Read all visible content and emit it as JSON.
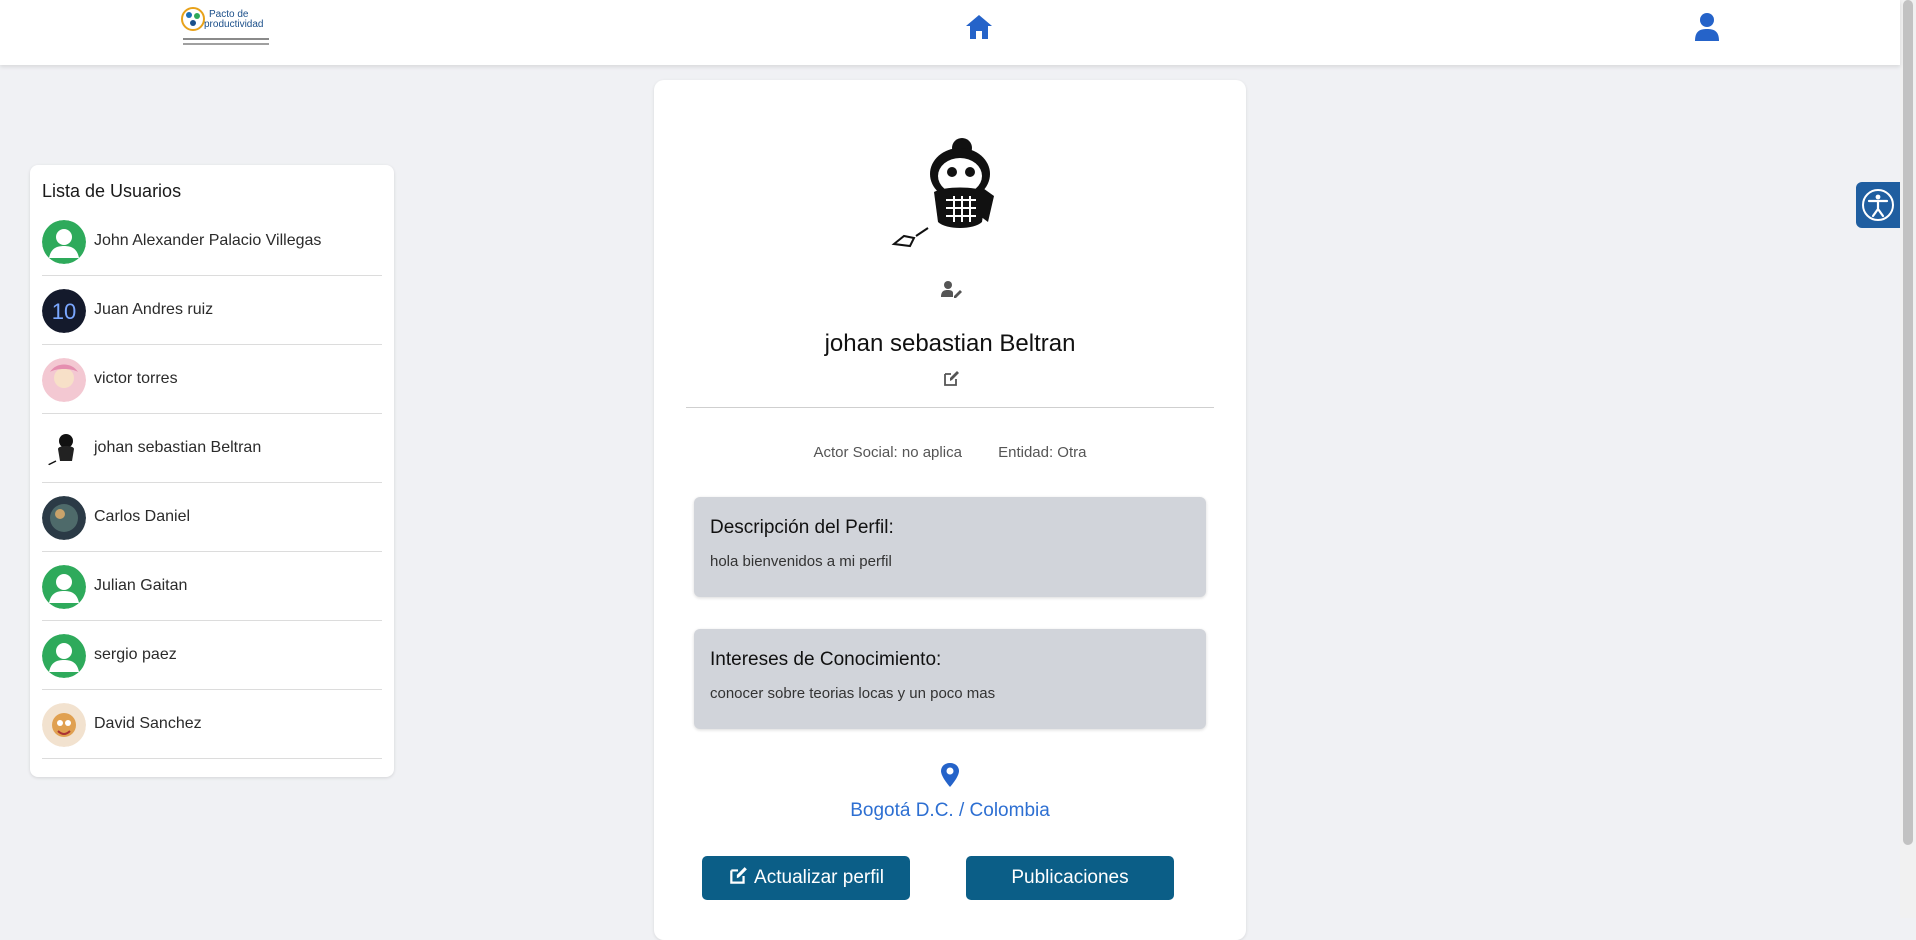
{
  "header": {
    "logo_line1": "Pacto de",
    "logo_line2": "productividad",
    "home_icon": "home-icon",
    "user_icon": "user-icon"
  },
  "sidebar": {
    "title": "Lista de Usuarios",
    "users": [
      {
        "name": "John Alexander Palacio Villegas",
        "avatar": "default-avatar"
      },
      {
        "name": "Juan Andres ruiz",
        "avatar": "photo-avatar"
      },
      {
        "name": "victor torres",
        "avatar": "photo-avatar"
      },
      {
        "name": "johan sebastian Beltran",
        "avatar": "photo-avatar"
      },
      {
        "name": "Carlos Daniel",
        "avatar": "photo-avatar"
      },
      {
        "name": "Julian Gaitan",
        "avatar": "default-avatar"
      },
      {
        "name": "sergio paez",
        "avatar": "default-avatar"
      },
      {
        "name": "David Sanchez",
        "avatar": "photo-avatar"
      }
    ]
  },
  "profile": {
    "name": "johan sebastian Beltran",
    "actor_social": "Actor Social: no aplica",
    "entidad": "Entidad: Otra",
    "description_title": "Descripción del Perfil:",
    "description_text": "hola bienvenidos a mi perfil",
    "interests_title": "Intereses de Conocimiento:",
    "interests_text": "conocer sobre teorias locas y un poco mas",
    "location": "Bogotá D.C. / Colombia",
    "update_button": "Actualizar perfil",
    "posts_button": "Publicaciones"
  },
  "colors": {
    "primary_button": "#0b5e87",
    "link_blue": "#2d6fd2",
    "info_box": "#d1d4da",
    "avatar_green": "#2eaa5b"
  }
}
